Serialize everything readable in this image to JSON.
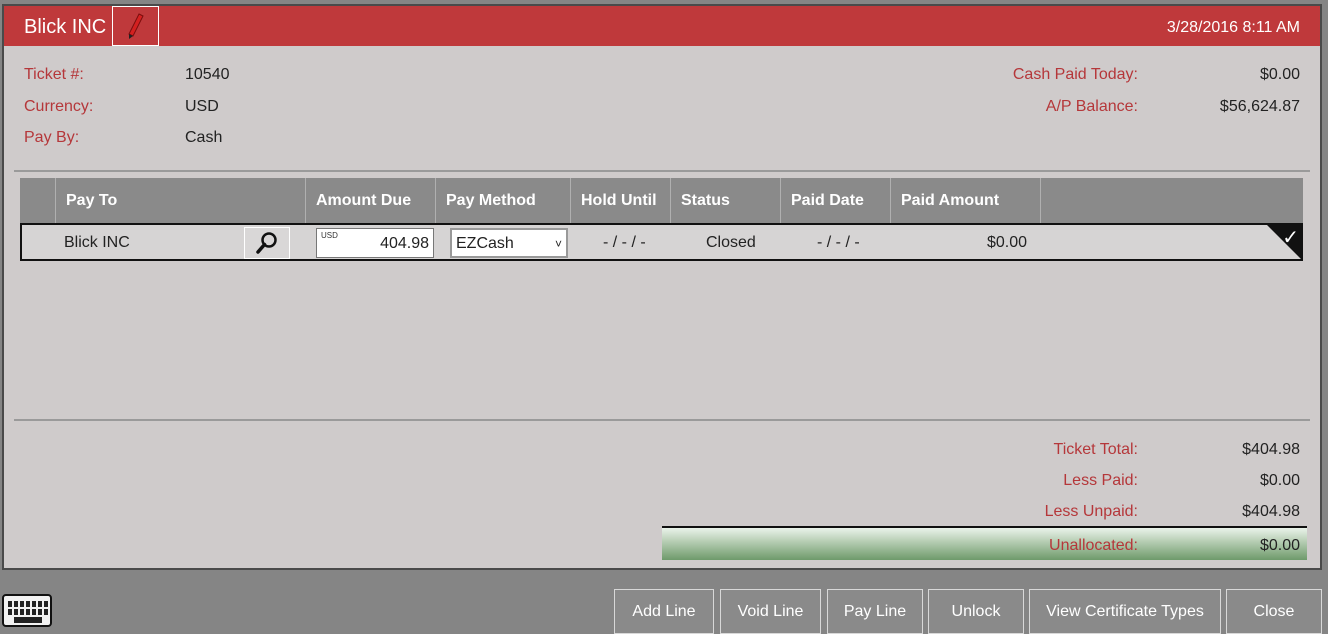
{
  "header": {
    "title": "Blick INC",
    "datetime": "3/28/2016 8:11 AM"
  },
  "info": {
    "ticket_label": "Ticket #:",
    "ticket_value": "10540",
    "currency_label": "Currency:",
    "currency_value": "USD",
    "payby_label": "Pay By:",
    "payby_value": "Cash",
    "cash_paid_label": "Cash Paid Today:",
    "cash_paid_value": "$0.00",
    "ap_balance_label": "A/P Balance:",
    "ap_balance_value": "$56,624.87"
  },
  "grid": {
    "columns": [
      "Pay To",
      "Amount Due",
      "Pay Method",
      "Hold Until",
      "Status",
      "Paid Date",
      "Paid Amount"
    ],
    "row": {
      "pay_to": "Blick INC",
      "currency": "USD",
      "amount_due": "404.98",
      "pay_method": "EZCash",
      "hold_until": "- / - / -",
      "status": "Closed",
      "paid_date": "- / - / -",
      "paid_amount": "$0.00"
    }
  },
  "totals": {
    "ticket_total_label": "Ticket Total:",
    "ticket_total_value": "$404.98",
    "less_paid_label": "Less Paid:",
    "less_paid_value": "$0.00",
    "less_unpaid_label": "Less Unpaid:",
    "less_unpaid_value": "$404.98",
    "unallocated_label": "Unallocated:",
    "unallocated_value": "$0.00"
  },
  "buttons": {
    "add_line": "Add Line",
    "void_line": "Void Line",
    "pay_line": "Pay Line",
    "unlock": "Unlock",
    "view_cert": "View Certificate Types",
    "close": "Close"
  },
  "icons": {
    "edit": "pencil-icon",
    "search": "search-icon",
    "check": "check-icon",
    "keyboard": "keyboard-icon"
  },
  "colors": {
    "title_bar": "#bf393b",
    "label_red": "#b5373a",
    "panel_bg": "#cfcbcb",
    "grid_header": "#8a8a8a",
    "button_bg": "#8a8a8a"
  }
}
